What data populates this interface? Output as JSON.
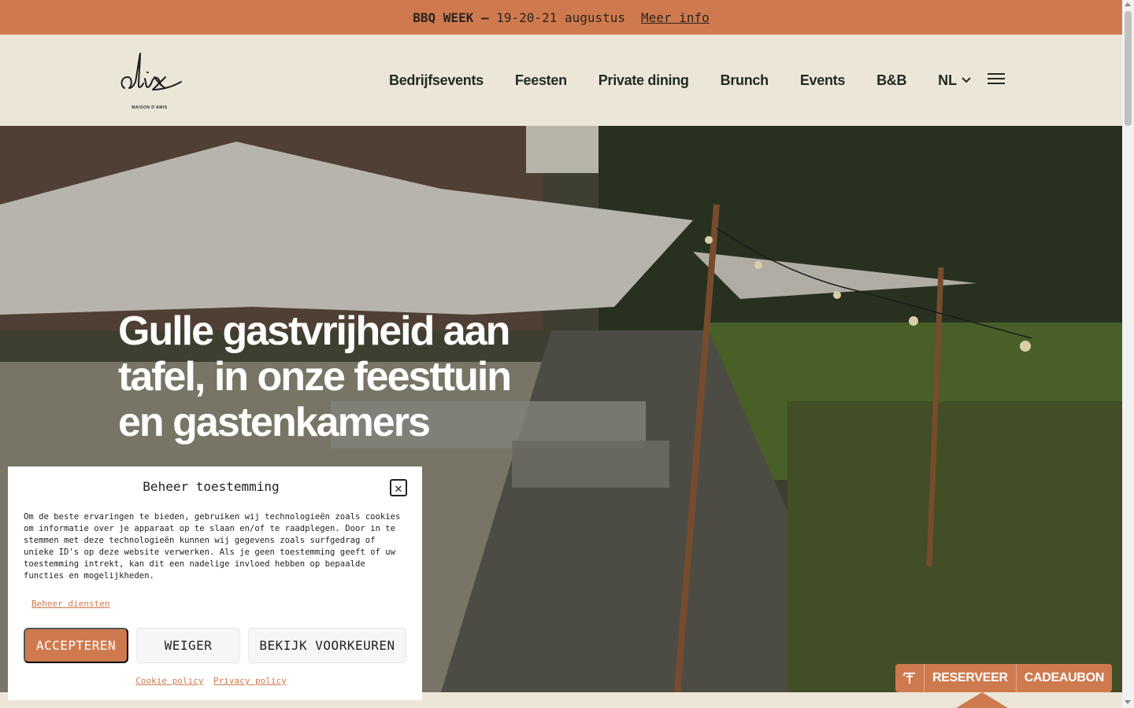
{
  "announcement": {
    "event": "BBQ WEEK",
    "separator": "—",
    "dates": "19-20-21 augustus",
    "link": "Meer info"
  },
  "header": {
    "logo_text": "alix",
    "logo_subtitle": "MAISON D'AMIS",
    "nav": [
      "Bedrijfsevents",
      "Feesten",
      "Private dining",
      "Brunch",
      "Events",
      "B&B"
    ],
    "language": "NL"
  },
  "hero": {
    "title": "Gulle gastvrijheid aan tafel, in onze feesttuin en gastenkamers"
  },
  "consent": {
    "title": "Beheer toestemming",
    "body": "Om de beste ervaringen te bieden, gebruiken wij technologieën zoals cookies om informatie over je apparaat op te slaan en/of te raadplegen. Door in te stemmen met deze technologieën kunnen wij gegevens zoals surfgedrag of unieke ID's op deze website verwerken. Als je geen toestemming geeft of uw toestemming intrekt, kan dit een nadelige invloed hebben op bepaalde functies en mogelijkheden.",
    "manage_link": "Beheer diensten",
    "accept": "ACCEPTEREN",
    "deny": "WEIGER",
    "preferences": "BEKIJK VOORKEUREN",
    "cookie_policy": "Cookie policy",
    "privacy_policy": "Privacy policy"
  },
  "cta": {
    "reserve": "RESERVEER",
    "giftcard": "CADEAUBON"
  },
  "colors": {
    "accent": "#cf7a4e",
    "cream": "#ece6d9",
    "dark_text": "#1f2a22"
  }
}
